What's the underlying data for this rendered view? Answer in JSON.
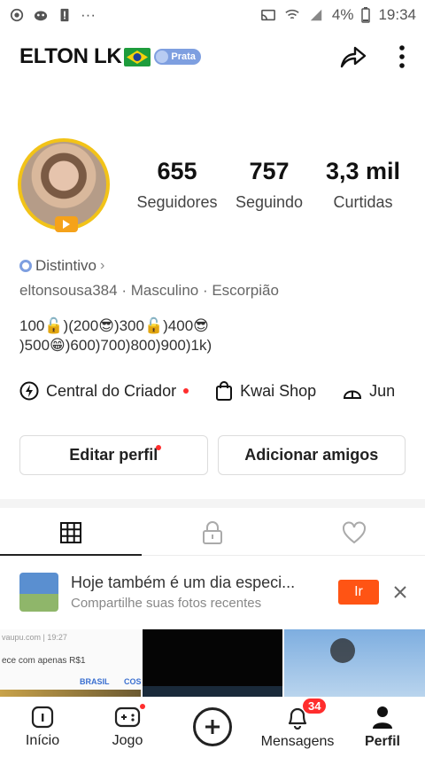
{
  "status_bar": {
    "battery": "4%",
    "time": "19:34",
    "more": "···"
  },
  "header": {
    "username": "ELTON LK",
    "rank_badge": "Prata",
    "share_icon": "share-icon",
    "menu_icon": "more-vertical-icon"
  },
  "stats": [
    {
      "value": "655",
      "label": "Seguidores"
    },
    {
      "value": "757",
      "label": "Seguindo"
    },
    {
      "value": "3,3 mil",
      "label": "Curtidas"
    }
  ],
  "distintivo": "Distintivo",
  "meta": "eltonsousa384 · Masculino · Escorpião",
  "bio": {
    "line1": "100🔓)(200😎)300🔓)400😎",
    "line2": ")500😁)600)700)800)900)1k)"
  },
  "links": [
    {
      "label": "Central do Criador",
      "icon": "lightning-icon",
      "has_dot": true
    },
    {
      "label": "Kwai Shop",
      "icon": "bag-icon",
      "has_dot": false
    },
    {
      "label": "Jun",
      "icon": "tent-icon",
      "has_dot": false
    }
  ],
  "buttons": {
    "edit_profile": "Editar perfil",
    "add_friends": "Adicionar amigos"
  },
  "tabs": [
    {
      "icon": "grid-icon",
      "active": true
    },
    {
      "icon": "lock-icon",
      "active": false
    },
    {
      "icon": "heart-icon",
      "active": false
    }
  ],
  "banner": {
    "title": "Hoje também é um dia especi...",
    "subtitle": "Compartilhe suas fotos recentes",
    "action": "Ir"
  },
  "thumbnails": {
    "thumb1_url": "vaupu.com | 19:27",
    "thumb1_text": "ece com apenas R$1",
    "thumb1_link_a": "BRASIL",
    "thumb1_link_b": "COS"
  },
  "bottom_nav": {
    "items": [
      {
        "label": "Início",
        "icon": "home-icon"
      },
      {
        "label": "Jogo",
        "icon": "gamepad-icon"
      },
      {
        "label": "",
        "icon": "plus-icon"
      },
      {
        "label": "Mensagens",
        "icon": "bell-icon",
        "badge": "34"
      },
      {
        "label": "Perfil",
        "icon": "person-icon"
      }
    ]
  },
  "colors": {
    "accent": "#ff5414",
    "badge_red": "#ff2d2d",
    "rank_blue": "#7e9fe0",
    "avatar_ring": "#f2c318"
  }
}
